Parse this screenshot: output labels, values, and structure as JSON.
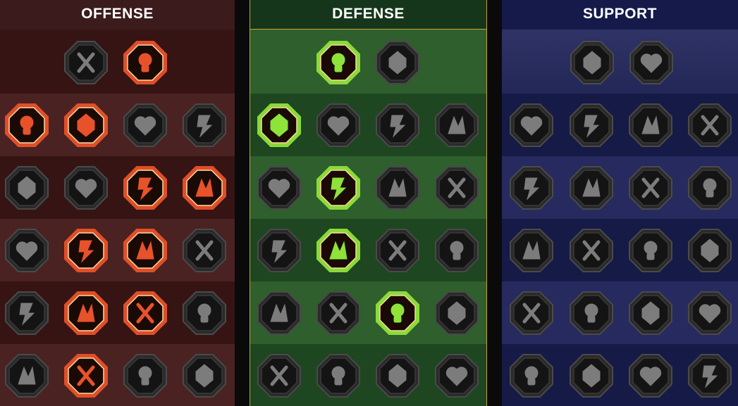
{
  "trees": [
    {
      "id": "offense",
      "title": "OFFENSE",
      "accent": "#e8522a",
      "tiers": [
        {
          "nodes": [
            {
              "icon": "crossed-swords-icon",
              "active": false
            },
            {
              "icon": "dagger-icon",
              "active": true
            }
          ]
        },
        {
          "nodes": [
            {
              "icon": "horned-demon-icon",
              "active": true
            },
            {
              "icon": "slash-sword-icon",
              "active": true
            },
            {
              "icon": "shield-arrow-icon",
              "active": false
            },
            {
              "icon": "broken-heart-icon",
              "active": false
            }
          ]
        },
        {
          "nodes": [
            {
              "icon": "fighter-icon",
              "active": false
            },
            {
              "icon": "fangs-icon",
              "active": false
            },
            {
              "icon": "skull-strike-icon",
              "active": true
            },
            {
              "icon": "bleeding-knife-icon",
              "active": true
            }
          ]
        },
        {
          "nodes": [
            {
              "icon": "sword-dagger-icon",
              "active": false
            },
            {
              "icon": "fist-hammer-icon",
              "active": true
            },
            {
              "icon": "axe-icon",
              "active": true
            },
            {
              "icon": "chain-lightning-icon",
              "active": false
            }
          ]
        },
        {
          "nodes": [
            {
              "icon": "claw-icon",
              "active": false
            },
            {
              "icon": "triple-skull-icon",
              "active": true
            },
            {
              "icon": "circle-blade-icon",
              "active": true
            },
            {
              "icon": "muscle-icon",
              "active": false
            }
          ]
        },
        {
          "nodes": [
            {
              "icon": "sparkle-sword-icon",
              "active": false
            },
            {
              "icon": "flaming-helmet-icon",
              "active": true
            },
            {
              "icon": "beast-icon",
              "active": false
            },
            {
              "icon": "radiant-skull-icon",
              "active": false
            }
          ]
        }
      ]
    },
    {
      "id": "defense",
      "title": "DEFENSE",
      "accent": "#8ee23a",
      "tiers": [
        {
          "nodes": [
            {
              "icon": "armor-plates-icon",
              "active": true
            },
            {
              "icon": "raised-fist-icon",
              "active": false
            }
          ]
        },
        {
          "nodes": [
            {
              "icon": "chevron-shield-icon",
              "active": true
            },
            {
              "icon": "heart-organ-icon",
              "active": false
            },
            {
              "icon": "golem-icon",
              "active": false
            },
            {
              "icon": "deflect-icon",
              "active": false
            }
          ]
        },
        {
          "nodes": [
            {
              "icon": "duelist-icon",
              "active": false
            },
            {
              "icon": "knight-shield-icon",
              "active": true
            },
            {
              "icon": "heart-hands-icon",
              "active": false
            },
            {
              "icon": "hooded-figure-icon",
              "active": false
            }
          ]
        },
        {
          "nodes": [
            {
              "icon": "crowd-icon",
              "active": false
            },
            {
              "icon": "hourglass-icon",
              "active": true
            },
            {
              "icon": "open-hand-icon",
              "active": false
            },
            {
              "icon": "bull-icon",
              "active": false
            }
          ]
        },
        {
          "nodes": [
            {
              "icon": "dash-runner-icon",
              "active": false
            },
            {
              "icon": "triple-flame-icon",
              "active": false
            },
            {
              "icon": "sun-skull-icon",
              "active": true
            },
            {
              "icon": "counter-arrow-icon",
              "active": false
            }
          ]
        },
        {
          "nodes": [
            {
              "icon": "tree-guardian-icon",
              "active": false
            },
            {
              "icon": "winged-shield-icon",
              "active": false
            },
            {
              "icon": "masked-face-icon",
              "active": false
            },
            {
              "icon": "strongman-icon",
              "active": false
            }
          ]
        }
      ]
    },
    {
      "id": "support",
      "title": "SUPPORT",
      "accent": "#6a78d8",
      "tiers": [
        {
          "nodes": [
            {
              "icon": "heart-sparkle-icon",
              "active": false
            },
            {
              "icon": "bound-hand-icon",
              "active": false
            }
          ]
        },
        {
          "nodes": [
            {
              "icon": "praying-hands-icon",
              "active": false
            },
            {
              "icon": "aura-shield-icon",
              "active": false
            },
            {
              "icon": "smoke-skull-icon",
              "active": false
            },
            {
              "icon": "speed-boot-icon",
              "active": false
            }
          ]
        },
        {
          "nodes": [
            {
              "icon": "magic-aura-icon",
              "active": false
            },
            {
              "icon": "lightning-shield-icon",
              "active": false
            },
            {
              "icon": "crack-icon",
              "active": false
            },
            {
              "icon": "shadow-figure-icon",
              "active": false
            }
          ]
        },
        {
          "nodes": [
            {
              "icon": "chained-heart-icon",
              "active": false
            },
            {
              "icon": "comet-icon",
              "active": false
            },
            {
              "icon": "open-book-icon",
              "active": false
            },
            {
              "icon": "angry-face-icon",
              "active": false
            }
          ]
        },
        {
          "nodes": [
            {
              "icon": "compass-star-icon",
              "active": false
            },
            {
              "icon": "winged-boot-icon",
              "active": false
            },
            {
              "icon": "eye-icon",
              "active": false
            },
            {
              "icon": "voodoo-doll-icon",
              "active": false
            }
          ]
        },
        {
          "nodes": [
            {
              "icon": "poison-flask-icon",
              "active": false
            },
            {
              "icon": "winged-skull-icon",
              "active": false
            },
            {
              "icon": "gripping-fist-icon",
              "active": false
            },
            {
              "icon": "eagle-icon",
              "active": false
            }
          ]
        }
      ]
    }
  ]
}
